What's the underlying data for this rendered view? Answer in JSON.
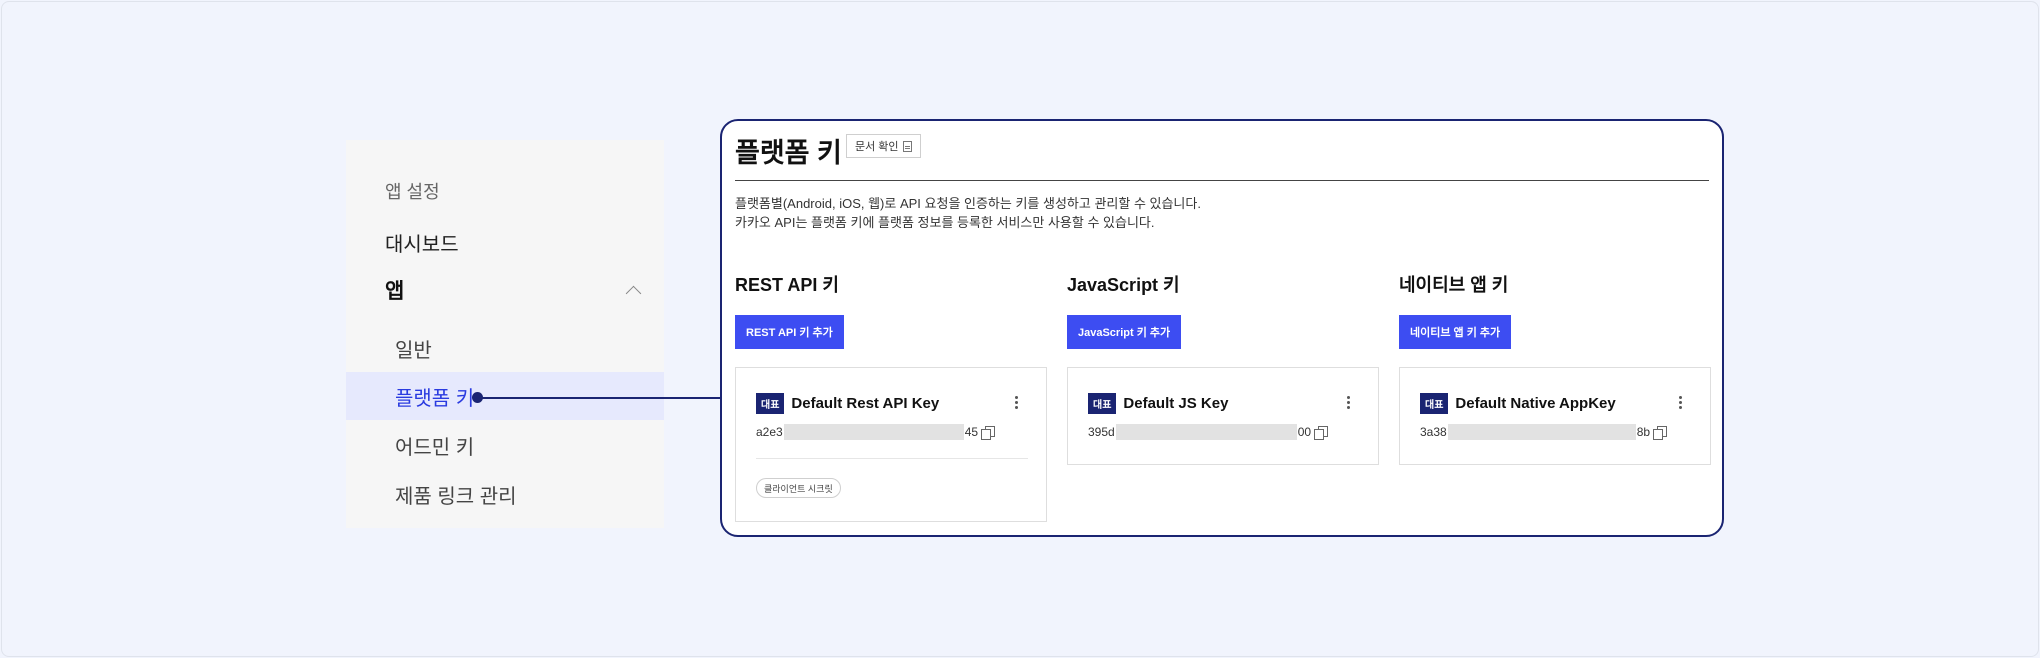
{
  "sidebar": {
    "section_label": "앱 설정",
    "dashboard_label": "대시보드",
    "app_label": "앱",
    "items": [
      {
        "label": "일반"
      },
      {
        "label": "플랫폼 키"
      },
      {
        "label": "어드민 키"
      },
      {
        "label": "제품 링크 관리"
      }
    ],
    "active_item": "플랫폼 키"
  },
  "panel": {
    "title": "플랫폼 키",
    "doc_button": "문서 확인",
    "description_line1": "플랫폼별(Android, iOS, 웹)로 API 요청을 인증하는 키를 생성하고 관리할 수 있습니다.",
    "description_line2": "카카오 API는 플랫폼 키에 플랫폼 정보를 등록한 서비스만 사용할 수 있습니다.",
    "columns": [
      {
        "title": "REST API 키",
        "add_button": "REST API 키 추가",
        "card": {
          "badge": "대표",
          "name": "Default Rest API Key",
          "key_prefix": "a2e3",
          "key_suffix": "45",
          "chip": "클라이언트 시크릿"
        }
      },
      {
        "title": "JavaScript 키",
        "add_button": "JavaScript 키 추가",
        "card": {
          "badge": "대표",
          "name": "Default JS Key",
          "key_prefix": "395d",
          "key_suffix": "00"
        }
      },
      {
        "title": "네이티브 앱 키",
        "add_button": "네이티브 앱 키 추가",
        "card": {
          "badge": "대표",
          "name": "Default Native AppKey",
          "key_prefix": "3a38",
          "key_suffix": "8b"
        }
      }
    ]
  },
  "icons": {
    "doc": "document-icon",
    "copy": "copy-icon",
    "more": "kebab-menu-icon",
    "chevron": "chevron-up-icon"
  },
  "colors": {
    "accent": "#3d4df2",
    "navy": "#1a2472",
    "active_bg": "#e6e9fd",
    "page_bg": "#f1f4fd"
  }
}
